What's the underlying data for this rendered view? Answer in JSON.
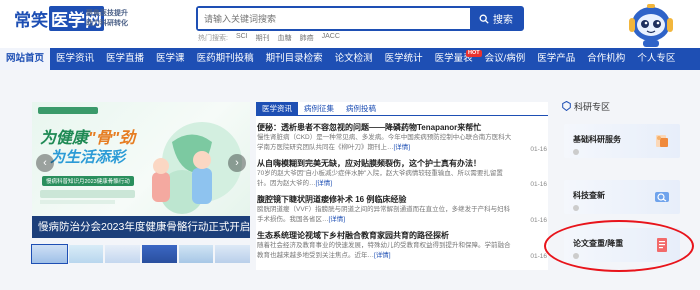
{
  "header": {
    "logo_text": "常笑",
    "logo_box": "医学网",
    "logo_sub": "",
    "slogan_line1": "聚焦医技提升",
    "slogan_line2": "助力科研转化"
  },
  "search": {
    "placeholder": "请输入关键词搜索",
    "button_label": "搜索",
    "hot_label": "热门搜索:",
    "hot_items": [
      "SCI",
      "期刊",
      "血糖",
      "肺癌",
      "JACC"
    ]
  },
  "nav": {
    "items": [
      "网站首页",
      "医学资讯",
      "医学直播",
      "医学课",
      "医药期刊投稿",
      "期刊目录检索",
      "论文检测",
      "医学统计",
      "医学量表",
      "会议/病例",
      "医学产品",
      "合作机构",
      "个人专区"
    ],
    "badge": "HOT"
  },
  "banner": {
    "caption": "慢病防治分会2023年度健康骨骼行动正式开启",
    "headline_1": "为健康",
    "headline_2": "\"骨\"劲",
    "headline_3": "为生活添彩",
    "subline": "慢病科普知识月2023健康骨骼行动",
    "prev": "‹",
    "next": "›"
  },
  "news": {
    "tabs": [
      "医学资讯",
      "病例征集",
      "病例投稿"
    ],
    "items": [
      {
        "title": "便秘：透析患者不容忽视的问题——降磷药物Tenapanor来帮忙",
        "desc": "慢性肾脏病（CKD）是一种常见病、多发病。今年中国疾病预防控制中心联合南方医科大学南方医院研究团队共同在《柳叶刀》期刊上…",
        "more": "[详情]",
        "date": "01-16"
      },
      {
        "title": "从自嗨模糊到完美无缺，应对贴膜频裂伤，这个护士真有办法！",
        "desc": "70岁的赵大爷因\"自小板减少症伴水肿\"入院，赵大爷病情较轻重输血、所以需要扎留置针。因为赵大爷的…",
        "more": "[详情]",
        "date": "01-16"
      },
      {
        "title": "腹腔镜下睫状阴道瘘修补术 16 例临床经验",
        "desc": "膀胱阴道瘘（VVF）指膀胱与阴道之间的异常解剖通道而在直立位，多继发于产科与妇科手术损伤。我国各省区…",
        "more": "[详情]",
        "date": "01-16"
      },
      {
        "title": "生态系统理论视域下乡村融合教育家园共育的路径探析",
        "desc": "随着社会经济及教育事业的快速发展，特殊幼儿的受教育权益得到提升和保障。学前融合教育也越来越多地受到关注焦点。近年…",
        "more": "[详情]",
        "date": "01-16"
      }
    ]
  },
  "sidebar": {
    "title": "科研专区",
    "cards": [
      "基础科研服务",
      "科技查新",
      "论文查重/降重"
    ]
  },
  "colors": {
    "brand_blue": "#1e4fb4",
    "highlight_red": "#e8141b",
    "hot_badge": "#e9322f"
  }
}
